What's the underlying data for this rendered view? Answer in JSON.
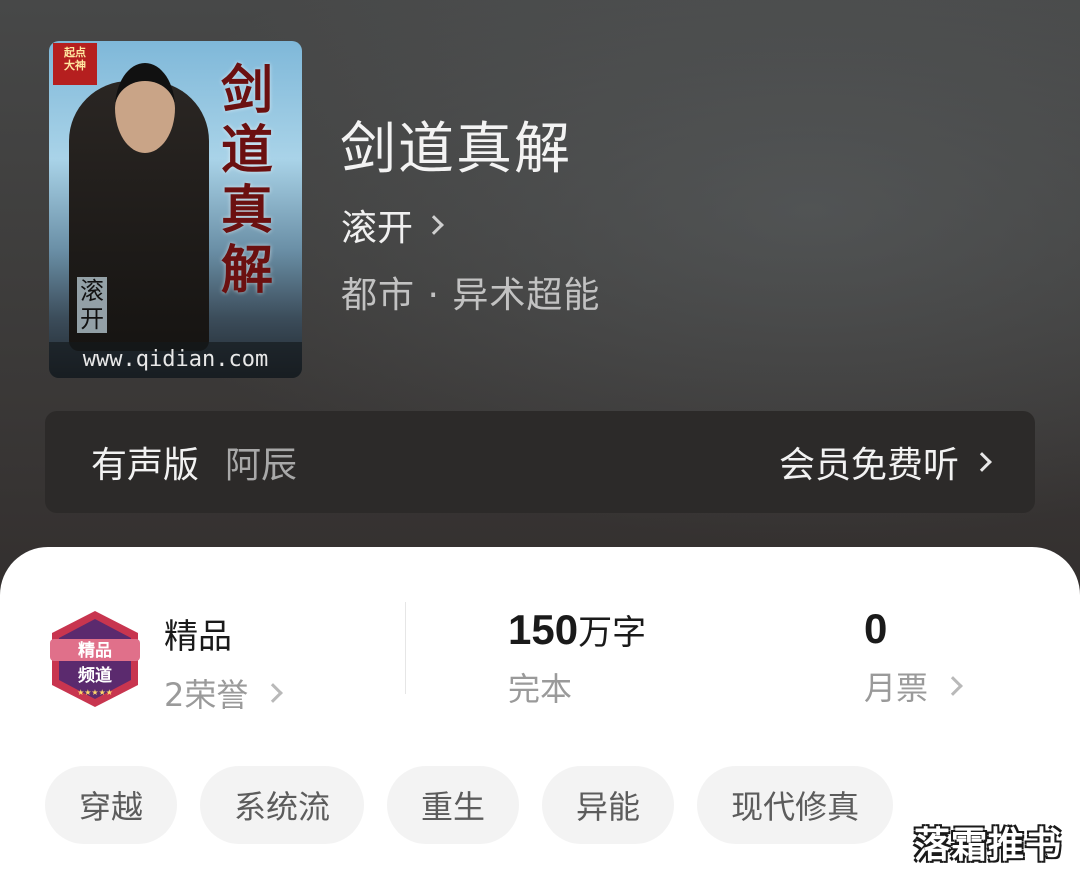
{
  "book": {
    "title": "剑道真解",
    "author": "滚开",
    "genre": "都市 · 异术超能",
    "cover": {
      "badge_text": "起点\n大神",
      "title_text": "剑道真解",
      "author_text": "滚开",
      "url_text": "www.qidian.com"
    }
  },
  "audio": {
    "label": "有声版",
    "narrator": "阿辰",
    "cta": "会员免费听"
  },
  "stats": {
    "badge_icon": "精品频道-badge-icon",
    "honor_title": "精品",
    "honor_sub": "2荣誉",
    "words_number": "150",
    "words_unit": "万字",
    "status": "完本",
    "monthly_tickets": "0",
    "monthly_tickets_label": "月票"
  },
  "tags": [
    "穿越",
    "系统流",
    "重生",
    "异能",
    "现代修真"
  ],
  "watermark": "落霜推书",
  "colors": {
    "card_bg": "#ffffff",
    "hero_bg": "#3e3d3c",
    "badge_purple": "#5b2a6e",
    "badge_red": "#c8354f"
  }
}
